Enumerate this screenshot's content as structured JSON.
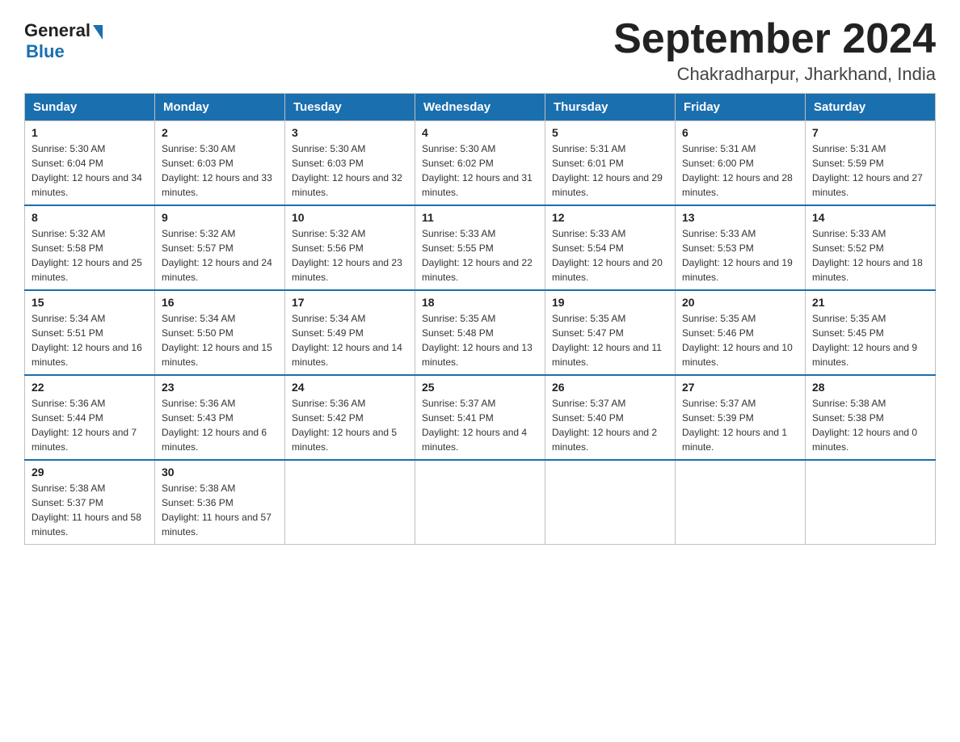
{
  "header": {
    "logo_general": "General",
    "logo_blue": "Blue",
    "month_year": "September 2024",
    "location": "Chakradharpur, Jharkhand, India"
  },
  "weekdays": [
    "Sunday",
    "Monday",
    "Tuesday",
    "Wednesday",
    "Thursday",
    "Friday",
    "Saturday"
  ],
  "weeks": [
    [
      {
        "day": "1",
        "sunrise": "5:30 AM",
        "sunset": "6:04 PM",
        "daylight": "12 hours and 34 minutes."
      },
      {
        "day": "2",
        "sunrise": "5:30 AM",
        "sunset": "6:03 PM",
        "daylight": "12 hours and 33 minutes."
      },
      {
        "day": "3",
        "sunrise": "5:30 AM",
        "sunset": "6:03 PM",
        "daylight": "12 hours and 32 minutes."
      },
      {
        "day": "4",
        "sunrise": "5:30 AM",
        "sunset": "6:02 PM",
        "daylight": "12 hours and 31 minutes."
      },
      {
        "day": "5",
        "sunrise": "5:31 AM",
        "sunset": "6:01 PM",
        "daylight": "12 hours and 29 minutes."
      },
      {
        "day": "6",
        "sunrise": "5:31 AM",
        "sunset": "6:00 PM",
        "daylight": "12 hours and 28 minutes."
      },
      {
        "day": "7",
        "sunrise": "5:31 AM",
        "sunset": "5:59 PM",
        "daylight": "12 hours and 27 minutes."
      }
    ],
    [
      {
        "day": "8",
        "sunrise": "5:32 AM",
        "sunset": "5:58 PM",
        "daylight": "12 hours and 25 minutes."
      },
      {
        "day": "9",
        "sunrise": "5:32 AM",
        "sunset": "5:57 PM",
        "daylight": "12 hours and 24 minutes."
      },
      {
        "day": "10",
        "sunrise": "5:32 AM",
        "sunset": "5:56 PM",
        "daylight": "12 hours and 23 minutes."
      },
      {
        "day": "11",
        "sunrise": "5:33 AM",
        "sunset": "5:55 PM",
        "daylight": "12 hours and 22 minutes."
      },
      {
        "day": "12",
        "sunrise": "5:33 AM",
        "sunset": "5:54 PM",
        "daylight": "12 hours and 20 minutes."
      },
      {
        "day": "13",
        "sunrise": "5:33 AM",
        "sunset": "5:53 PM",
        "daylight": "12 hours and 19 minutes."
      },
      {
        "day": "14",
        "sunrise": "5:33 AM",
        "sunset": "5:52 PM",
        "daylight": "12 hours and 18 minutes."
      }
    ],
    [
      {
        "day": "15",
        "sunrise": "5:34 AM",
        "sunset": "5:51 PM",
        "daylight": "12 hours and 16 minutes."
      },
      {
        "day": "16",
        "sunrise": "5:34 AM",
        "sunset": "5:50 PM",
        "daylight": "12 hours and 15 minutes."
      },
      {
        "day": "17",
        "sunrise": "5:34 AM",
        "sunset": "5:49 PM",
        "daylight": "12 hours and 14 minutes."
      },
      {
        "day": "18",
        "sunrise": "5:35 AM",
        "sunset": "5:48 PM",
        "daylight": "12 hours and 13 minutes."
      },
      {
        "day": "19",
        "sunrise": "5:35 AM",
        "sunset": "5:47 PM",
        "daylight": "12 hours and 11 minutes."
      },
      {
        "day": "20",
        "sunrise": "5:35 AM",
        "sunset": "5:46 PM",
        "daylight": "12 hours and 10 minutes."
      },
      {
        "day": "21",
        "sunrise": "5:35 AM",
        "sunset": "5:45 PM",
        "daylight": "12 hours and 9 minutes."
      }
    ],
    [
      {
        "day": "22",
        "sunrise": "5:36 AM",
        "sunset": "5:44 PM",
        "daylight": "12 hours and 7 minutes."
      },
      {
        "day": "23",
        "sunrise": "5:36 AM",
        "sunset": "5:43 PM",
        "daylight": "12 hours and 6 minutes."
      },
      {
        "day": "24",
        "sunrise": "5:36 AM",
        "sunset": "5:42 PM",
        "daylight": "12 hours and 5 minutes."
      },
      {
        "day": "25",
        "sunrise": "5:37 AM",
        "sunset": "5:41 PM",
        "daylight": "12 hours and 4 minutes."
      },
      {
        "day": "26",
        "sunrise": "5:37 AM",
        "sunset": "5:40 PM",
        "daylight": "12 hours and 2 minutes."
      },
      {
        "day": "27",
        "sunrise": "5:37 AM",
        "sunset": "5:39 PM",
        "daylight": "12 hours and 1 minute."
      },
      {
        "day": "28",
        "sunrise": "5:38 AM",
        "sunset": "5:38 PM",
        "daylight": "12 hours and 0 minutes."
      }
    ],
    [
      {
        "day": "29",
        "sunrise": "5:38 AM",
        "sunset": "5:37 PM",
        "daylight": "11 hours and 58 minutes."
      },
      {
        "day": "30",
        "sunrise": "5:38 AM",
        "sunset": "5:36 PM",
        "daylight": "11 hours and 57 minutes."
      },
      null,
      null,
      null,
      null,
      null
    ]
  ]
}
